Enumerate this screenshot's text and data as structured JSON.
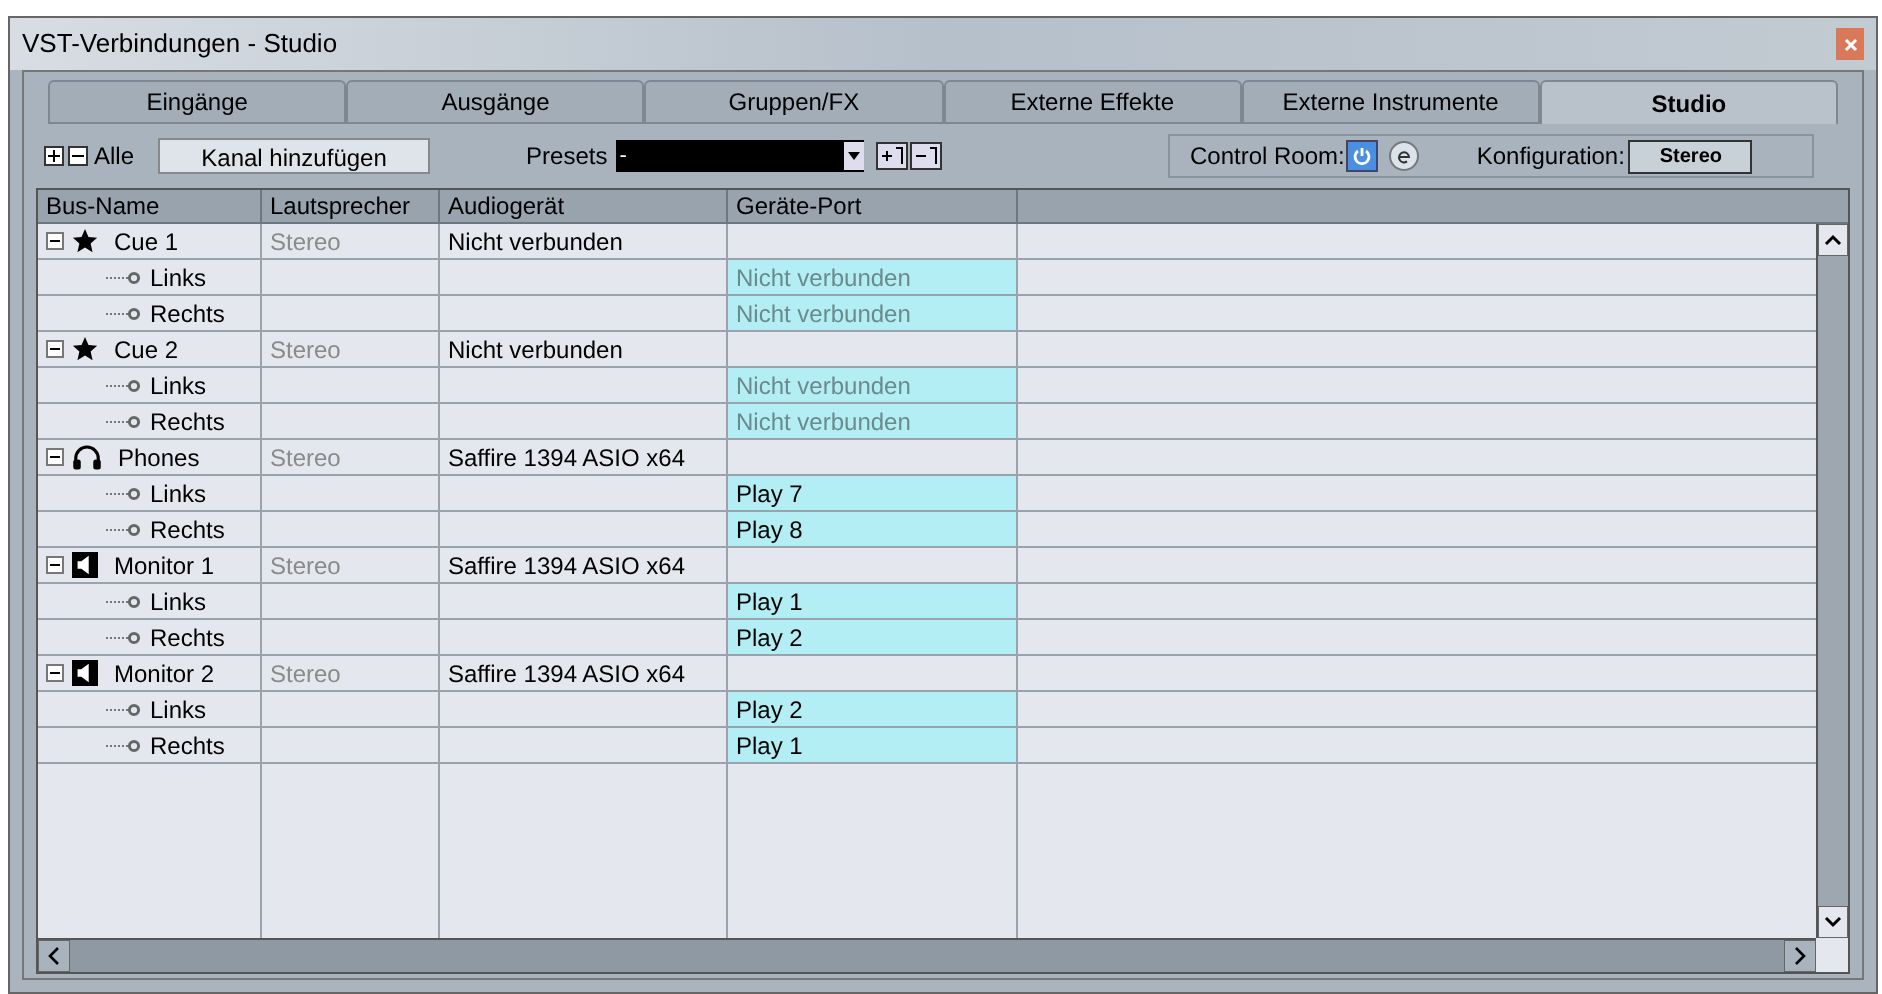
{
  "window": {
    "title": "VST-Verbindungen - Studio"
  },
  "tabs": [
    {
      "label": "Eingänge",
      "selected": false
    },
    {
      "label": "Ausgänge",
      "selected": false
    },
    {
      "label": "Gruppen/FX",
      "selected": false
    },
    {
      "label": "Externe Effekte",
      "selected": false
    },
    {
      "label": "Externe Instrumente",
      "selected": false
    },
    {
      "label": "Studio",
      "selected": true
    }
  ],
  "toolbar": {
    "expand_all_label": "Alle",
    "add_button": "Kanal hinzufügen",
    "presets_label": "Presets",
    "presets_value": "-",
    "control_room_label": "Control Room:",
    "control_room_on": true,
    "configuration_label": "Konfiguration:",
    "configuration_value": "Stereo"
  },
  "table": {
    "columns": [
      "Bus-Name",
      "Lautsprecher",
      "Audiogerät",
      "Geräte-Port"
    ],
    "rows": [
      {
        "name": "Cue 1",
        "kind": "star",
        "expanded": true,
        "speaker": "Stereo",
        "device": "Nicht verbunden",
        "children": [
          {
            "name": "Links",
            "port": "Nicht verbunden",
            "connected": false
          },
          {
            "name": "Rechts",
            "port": "Nicht verbunden",
            "connected": false
          }
        ]
      },
      {
        "name": "Cue 2",
        "kind": "star",
        "expanded": true,
        "speaker": "Stereo",
        "device": "Nicht verbunden",
        "children": [
          {
            "name": "Links",
            "port": "Nicht verbunden",
            "connected": false
          },
          {
            "name": "Rechts",
            "port": "Nicht verbunden",
            "connected": false
          }
        ]
      },
      {
        "name": "Phones",
        "kind": "headphones",
        "expanded": true,
        "speaker": "Stereo",
        "device": "Saffire 1394 ASIO x64",
        "children": [
          {
            "name": "Links",
            "port": "Play 7",
            "connected": true
          },
          {
            "name": "Rechts",
            "port": "Play 8",
            "connected": true
          }
        ]
      },
      {
        "name": "Monitor 1",
        "kind": "speaker",
        "expanded": true,
        "speaker": "Stereo",
        "device": "Saffire 1394 ASIO x64",
        "children": [
          {
            "name": "Links",
            "port": "Play 1",
            "connected": true
          },
          {
            "name": "Rechts",
            "port": "Play 2",
            "connected": true
          }
        ]
      },
      {
        "name": "Monitor 2",
        "kind": "speaker",
        "expanded": true,
        "speaker": "Stereo",
        "device": "Saffire 1394 ASIO x64",
        "children": [
          {
            "name": "Links",
            "port": "Play 2",
            "connected": true
          },
          {
            "name": "Rechts",
            "port": "Play 1",
            "connected": true
          }
        ]
      }
    ]
  }
}
